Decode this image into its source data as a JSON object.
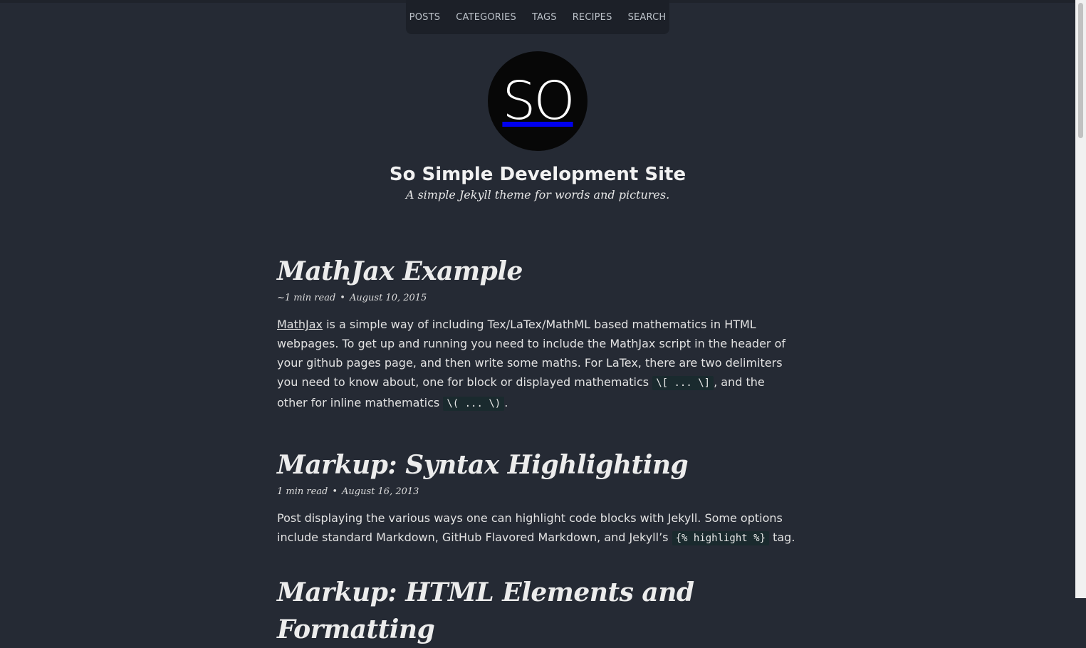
{
  "nav": {
    "items": [
      {
        "label": "POSTS"
      },
      {
        "label": "CATEGORIES"
      },
      {
        "label": "TAGS"
      },
      {
        "label": "RECIPES"
      },
      {
        "label": "SEARCH"
      }
    ]
  },
  "logo": {
    "text": "SO"
  },
  "site": {
    "title": "So Simple Development Site",
    "description": "A simple Jekyll theme for words and pictures."
  },
  "posts": [
    {
      "title": "MathJax Example",
      "read_time": "~1 min read",
      "date": "August 10, 2015",
      "excerpt": {
        "link": "MathJax",
        "t1": " is a simple way of including Tex/LaTex/MathML based mathematics in HTML webpages. To get up and running you need to include the MathJax script in the header of your github pages page, and then write some maths. For LaTex, there are two delimiters you need to know about, one for block or displayed mathematics ",
        "code1": "\\[ ... \\]",
        "t2": ", and the other for inline mathematics ",
        "code2": "\\( ... \\)",
        "t3": "."
      }
    },
    {
      "title": "Markup: Syntax Highlighting",
      "read_time": "1 min read",
      "date": "August 16, 2013",
      "excerpt": {
        "t1": "Post displaying the various ways one can highlight code blocks with Jekyll. Some options include standard Markdown, GitHub Flavored Markdown, and Jekyll’s ",
        "code1": "{% highlight %}",
        "t2": " tag."
      }
    },
    {
      "title": "Markup: HTML Elements and Formatting"
    }
  ],
  "colors": {
    "background": "#252a34",
    "nav_background": "#1c2028",
    "logo_background": "#070707",
    "code_background": "#1a2a2e",
    "text": "#e8e8e8"
  }
}
